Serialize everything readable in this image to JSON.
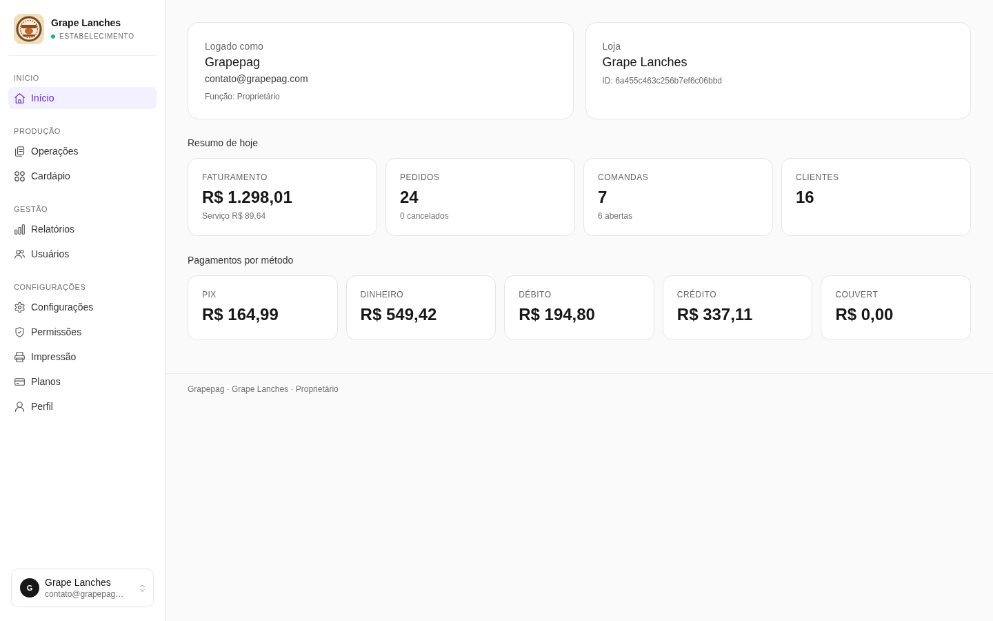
{
  "sidebar": {
    "brand": {
      "name": "Grape Lanches",
      "subtitle": "ESTABELECIMENTO",
      "online": true
    },
    "sections": [
      {
        "title": "INÍCIO",
        "items": [
          {
            "label": "Início",
            "selected": true
          }
        ]
      },
      {
        "title": "PRODUÇÃO",
        "items": [
          {
            "label": "Operações",
            "selected": false
          },
          {
            "label": "Cardápio",
            "selected": false
          }
        ]
      },
      {
        "title": "GESTÃO",
        "items": [
          {
            "label": "Relatórios",
            "selected": false
          },
          {
            "label": "Usuários",
            "selected": false
          }
        ]
      },
      {
        "title": "CONFIGURAÇÕES",
        "items": [
          {
            "label": "Configurações",
            "selected": false
          },
          {
            "label": "Permissões",
            "selected": false
          },
          {
            "label": "Impressão",
            "selected": false
          },
          {
            "label": "Planos",
            "selected": false
          },
          {
            "label": "Perfil",
            "selected": false
          }
        ]
      }
    ],
    "user": {
      "initial": "G",
      "name": "Grape Lanches",
      "email": "contato@grapepag…"
    }
  },
  "info_cards": [
    {
      "label": "Logado como",
      "title": "Grapepag",
      "details": [
        {
          "kind": "primary",
          "text": "contato@grapepag.com"
        },
        {
          "kind": "muted",
          "text": "Função: Proprietário"
        }
      ]
    },
    {
      "label": "Loja",
      "title": "Grape Lanches",
      "details": [
        {
          "kind": "muted",
          "text": "ID: 6a455c463c256b7ef6c06bbd"
        }
      ]
    }
  ],
  "summary": {
    "title": "Resumo de hoje",
    "cards": [
      {
        "label": "FATURAMENTO",
        "value": "R$ 1.298,01",
        "note": "Serviço R$ 89,64"
      },
      {
        "label": "PEDIDOS",
        "value": "24",
        "note": "0 cancelados"
      },
      {
        "label": "COMANDAS",
        "value": "7",
        "note": "6 abertas"
      },
      {
        "label": "CLIENTES",
        "value": "16"
      }
    ]
  },
  "payments": {
    "title": "Pagamentos por método",
    "cards": [
      {
        "label": "PIX",
        "value": "R$ 164,99"
      },
      {
        "label": "DINHEIRO",
        "value": "R$ 549,42"
      },
      {
        "label": "DÉBITO",
        "value": "R$ 194,80"
      },
      {
        "label": "CRÉDITO",
        "value": "R$ 337,11"
      },
      {
        "label": "COUVERT",
        "value": "R$ 0,00"
      }
    ]
  },
  "footer": "Grapepag · Grape Lanches · Proprietário"
}
